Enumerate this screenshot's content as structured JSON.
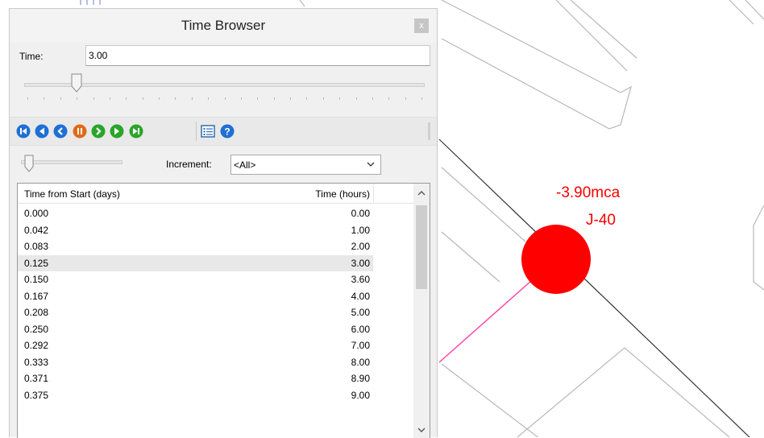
{
  "map": {
    "pressure_label": "-3.90mca",
    "node_label": "J-40",
    "node_color": "#ff0000",
    "pipe_color_highlight": "#ff3fa0"
  },
  "window": {
    "title": "Time Browser",
    "close_glyph": "x"
  },
  "time_field": {
    "label": "Time:",
    "value": "3.00"
  },
  "time_slider": {
    "position_fraction": 0.12
  },
  "toolbar": {
    "buttons": [
      {
        "name": "go-to-start-icon",
        "color": "#1f6fd6"
      },
      {
        "name": "step-back-icon",
        "color": "#1f6fd6"
      },
      {
        "name": "play-backward-icon",
        "color": "#1f6fd6"
      },
      {
        "name": "pause-icon",
        "color": "#e06a1b"
      },
      {
        "name": "play-forward-icon",
        "color": "#2aa52a"
      },
      {
        "name": "step-forward-icon",
        "color": "#2aa52a"
      },
      {
        "name": "go-to-end-icon",
        "color": "#2aa52a"
      },
      {
        "name": "options-list-icon",
        "color": "#2f6fb6"
      },
      {
        "name": "help-icon",
        "color": "#1f6fd6"
      }
    ]
  },
  "speed_slider": {
    "position_fraction": 0.0
  },
  "increment": {
    "label": "Increment:",
    "value": "<All>"
  },
  "table": {
    "columns": [
      "Time from Start (days)",
      "Time (hours)"
    ],
    "selected_row": 3,
    "rows": [
      [
        "0.000",
        "0.00"
      ],
      [
        "0.042",
        "1.00"
      ],
      [
        "0.083",
        "2.00"
      ],
      [
        "0.125",
        "3.00"
      ],
      [
        "0.150",
        "3.60"
      ],
      [
        "0.167",
        "4.00"
      ],
      [
        "0.208",
        "5.00"
      ],
      [
        "0.250",
        "6.00"
      ],
      [
        "0.292",
        "7.00"
      ],
      [
        "0.333",
        "8.00"
      ],
      [
        "0.371",
        "8.90"
      ],
      [
        "0.375",
        "9.00"
      ]
    ]
  }
}
